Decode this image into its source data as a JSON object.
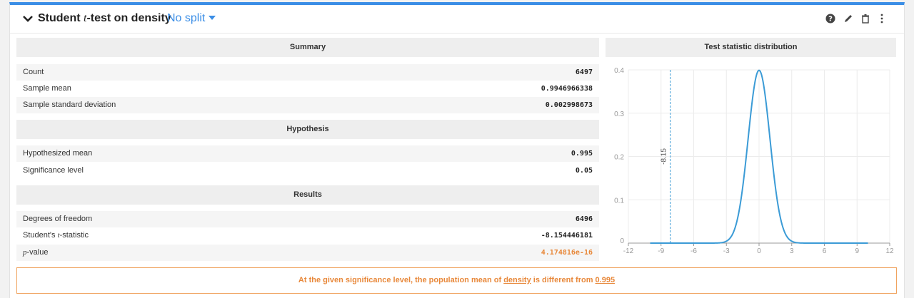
{
  "card": {
    "title_prefix": "Student ",
    "title_italic": "t",
    "title_suffix": "-test on density",
    "split_label": "No split"
  },
  "icons": [
    "collapse-chevron-icon",
    "help-icon",
    "edit-pencil-icon",
    "trash-icon",
    "more-vertical-icon"
  ],
  "summary": {
    "heading": "Summary",
    "rows": [
      {
        "label": "Count",
        "value": "6497"
      },
      {
        "label": "Sample mean",
        "value": "0.9946966338"
      },
      {
        "label": "Sample standard deviation",
        "value": "0.002998673"
      }
    ]
  },
  "hypothesis": {
    "heading": "Hypothesis",
    "rows": [
      {
        "label": "Hypothesized mean",
        "value": "0.995"
      },
      {
        "label": "Significance level",
        "value": "0.05"
      }
    ]
  },
  "results": {
    "heading": "Results",
    "dof_label": "Degrees of freedom",
    "dof_value": "6496",
    "tstat_label_prefix": "Student's ",
    "tstat_label_italic": "t",
    "tstat_label_suffix": "-statistic",
    "tstat_value": "-8.154446181",
    "pvalue_label_italic": "p",
    "pvalue_label_suffix": "-value",
    "pvalue_value": "4.174816e-16"
  },
  "conclusion": {
    "text_prefix": "At the given significance level, the population mean of ",
    "variable": "density",
    "text_middle": " is different from ",
    "reference": "0.995"
  },
  "chart_data": {
    "type": "line",
    "title": "Test statistic distribution",
    "series": [
      {
        "values": "standard normal density curve, x from -10 to 10"
      }
    ],
    "xlim": [
      -12,
      12
    ],
    "ylim": [
      0,
      0.4
    ],
    "xticks": [
      "-12",
      "-9",
      "-6",
      "-3",
      "0",
      "3",
      "6",
      "9",
      "12"
    ],
    "yticks": [
      "0",
      "0.1",
      "0.2",
      "0.3",
      "0.4"
    ],
    "marker_line": {
      "x": -8.15,
      "label": "-8.15"
    },
    "grid": true,
    "colors": {
      "curve": "#3b9bd6",
      "marker": "#3b9bd6"
    }
  }
}
